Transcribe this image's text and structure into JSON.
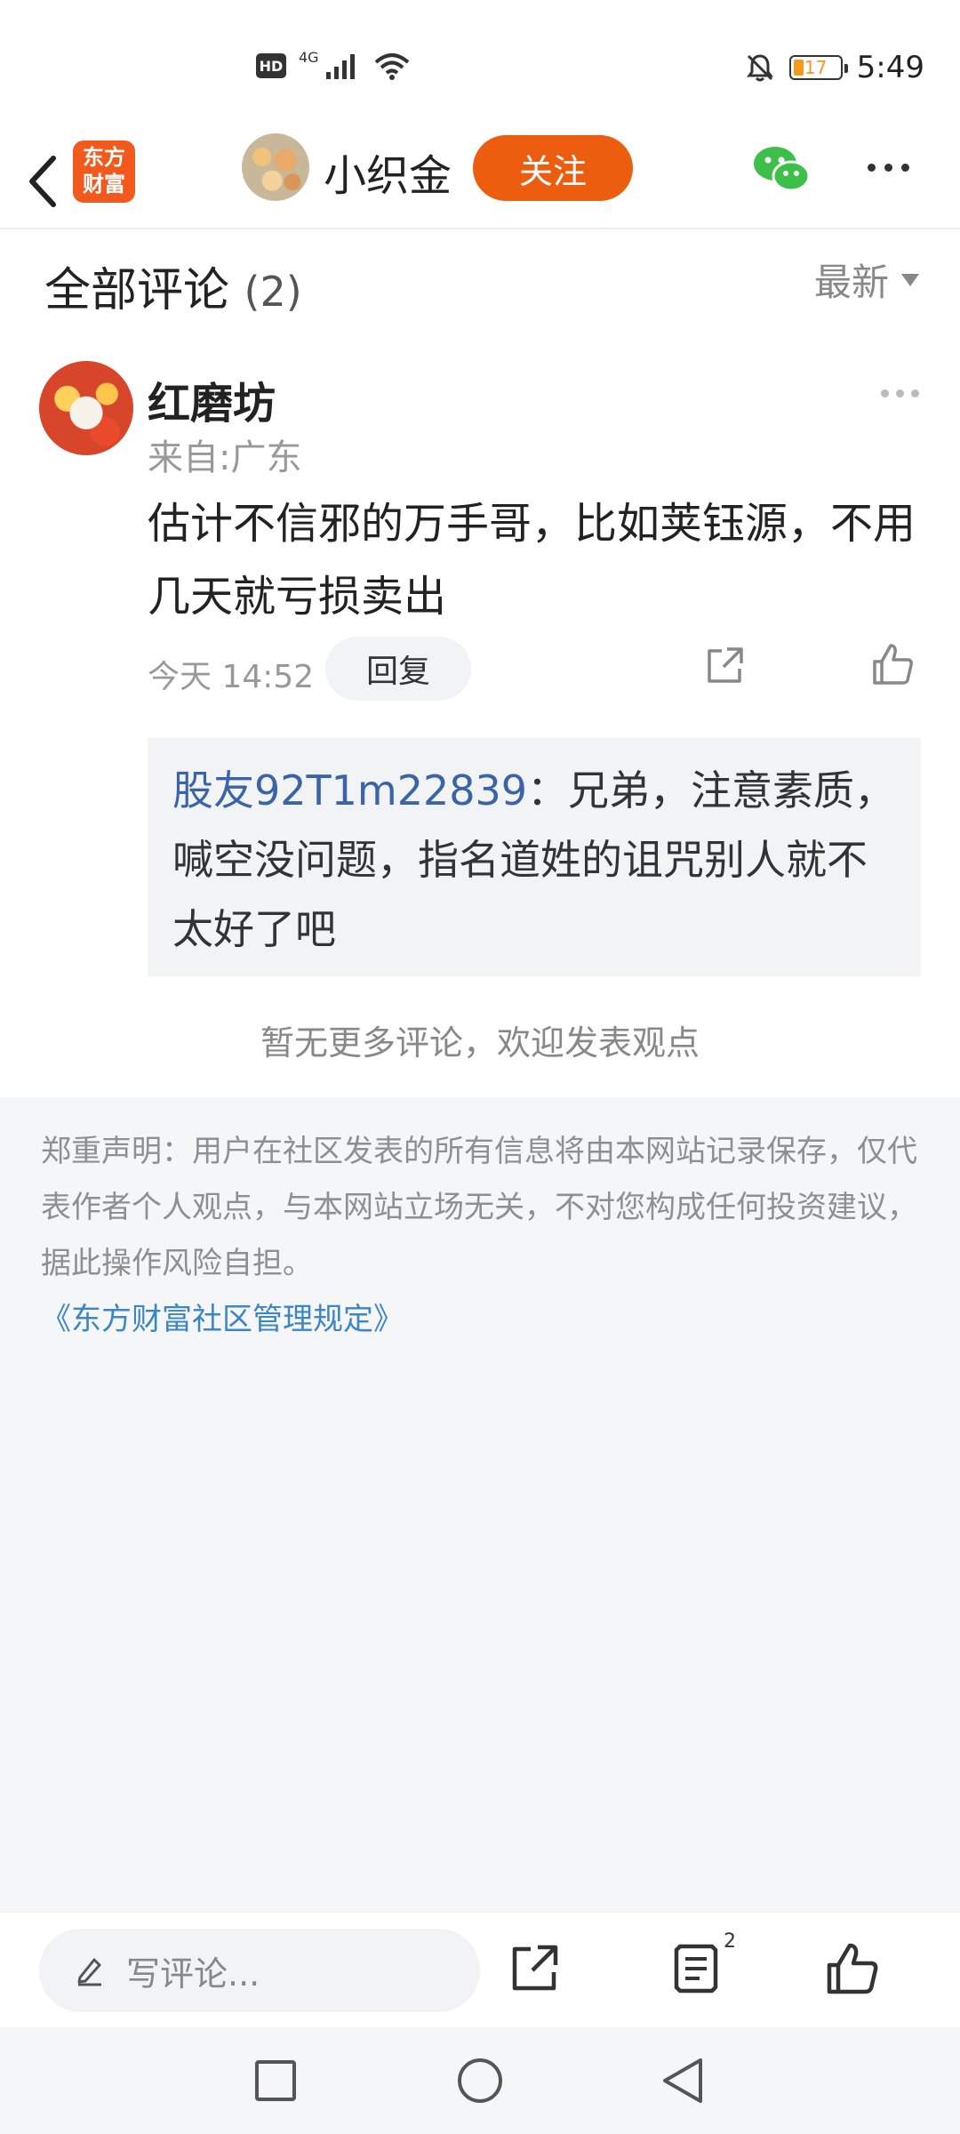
{
  "status_bar": {
    "network": "4G",
    "hd_label": "HD",
    "battery": "17",
    "time": "5:49"
  },
  "header": {
    "app_logo": "东方\n财富",
    "author_name": "小织金",
    "follow_label": "关注"
  },
  "comments": {
    "title": "全部评论",
    "count": "(2)",
    "sort_label": "最新",
    "item": {
      "user": "红磨坊",
      "location": "来自:广东",
      "body": "估计不信邪的万手哥，比如荚钰源，不用几天就亏损卖出",
      "time": "今天 14:52",
      "reply_label": "回复"
    },
    "reply": {
      "user": "股友92T1m22839",
      "text": "：兄弟，注意素质，喊空没问题，指名道姓的诅咒别人就不太好了吧"
    },
    "no_more": "暂无更多评论，欢迎发表观点"
  },
  "disclaimer": {
    "text": "郑重声明：用户在社区发表的所有信息将由本网站记录保存，仅代表作者个人观点，与本网站立场无关，不对您构成任何投资建议，据此操作风险自担。",
    "rules_link": "《东方财富社区管理规定》"
  },
  "bottom_bar": {
    "input_placeholder": "写评论...",
    "comment_badge": "2"
  },
  "colors": {
    "accent": "#ec5d10",
    "link": "#3b86c6",
    "reply_user": "#3b64a8"
  }
}
